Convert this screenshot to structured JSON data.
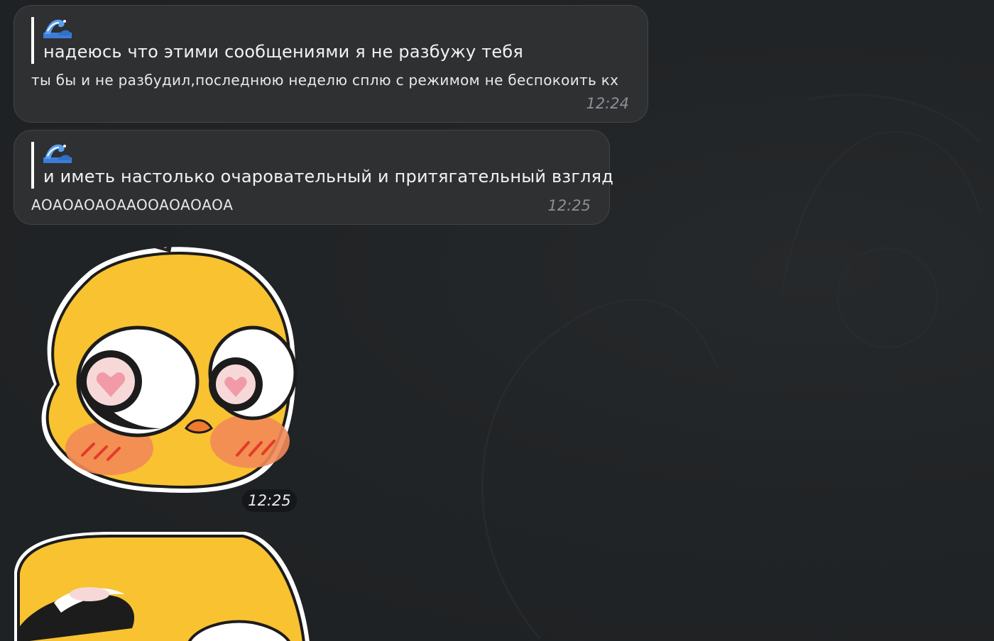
{
  "messages": [
    {
      "reply_icon": "wave-emoji",
      "reply_text": "надеюсь что этими сообщениями я не разбужу тебя",
      "text": "ты бы и не разбудил,последнюю неделю сплю с режимом не беспокоить кх",
      "time": "12:24"
    },
    {
      "reply_icon": "wave-emoji",
      "reply_text": "и иметь настолько очаровательный и притягательный взгляд",
      "text": "АОАОАОАОААООАОАОАОА",
      "time": "12:25"
    }
  ],
  "stickers": [
    {
      "name": "heart-eyes-duck-sticker",
      "time": "12:25"
    },
    {
      "name": "squinting-duck-sticker"
    }
  ],
  "colors": {
    "background": "#1f2224",
    "bubble": "#2f3032",
    "sticker_yellow": "#f8c231",
    "blush": "#f28a58"
  }
}
